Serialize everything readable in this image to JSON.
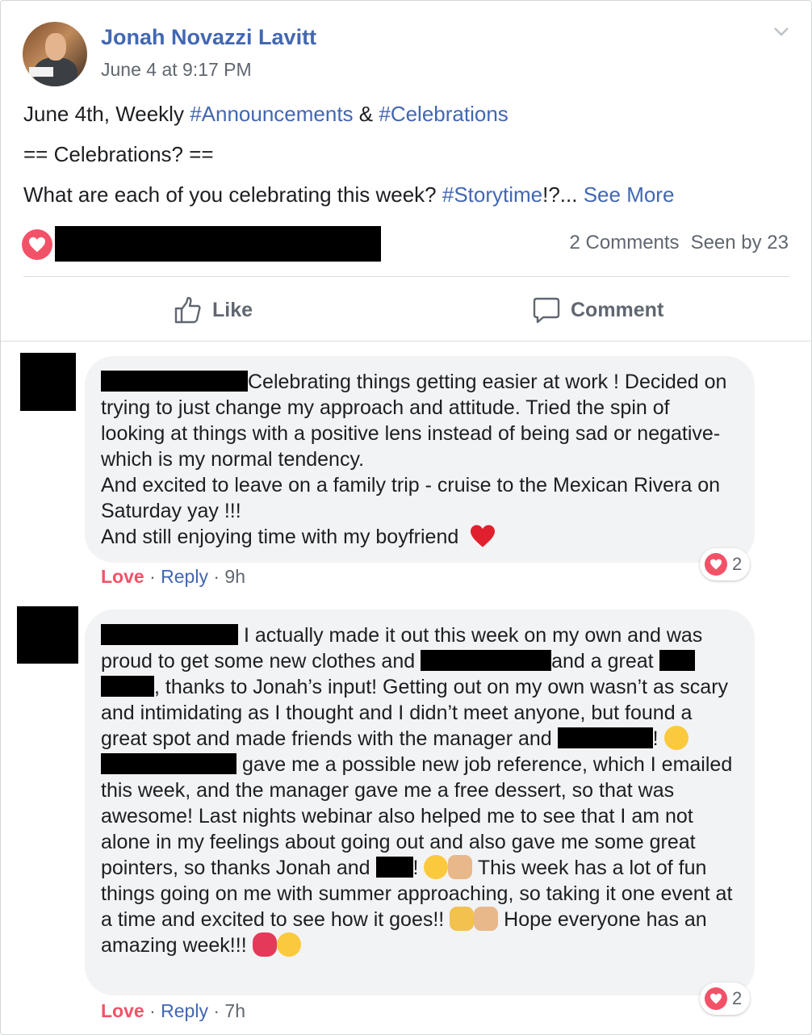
{
  "post": {
    "author": "Jonah Novazzi Lavitt",
    "timestamp": "June 4 at 9:17 PM",
    "line1": {
      "prefix": "June 4th, Weekly ",
      "tag1": "#Announcements",
      "amp": " & ",
      "tag2": "#Celebrations"
    },
    "line2": "== Celebrations? ==",
    "line3": {
      "text": "What are each of you celebrating this week? ",
      "tag": "#Storytime",
      "suffix": "!?... ",
      "see_more": "See More"
    },
    "comments_count": "2 Comments",
    "seen_by": "Seen by 23",
    "like_label": "Like",
    "comment_label": "Comment"
  },
  "comments": [
    {
      "text": "Celebrating things getting easier at work ! Decided on trying to just change my approach and attitude. Tried the spin of looking at things with a positive lens instead of being sad or negative- which is my normal tendency.",
      "l4": "And excited to leave on a family trip - cruise to the Mexican Rivera on Saturday yay !!!",
      "l6": "And still enjoying time with my boyfriend",
      "reaction_count": "2",
      "love": "Love",
      "reply": "Reply",
      "age": "9h"
    },
    {
      "s1": "I actually made it out this week on my own and was proud to get some new clothes and ",
      "s2": "and a great ",
      "s3": ", thanks to Jonah’s input! Getting out on my own wasn’t as scary and intimidating as I thought and I didn’t meet anyone, but found a great spot and made friends with the manager and ",
      "s4": "! ",
      "s5": " gave me a possible new job reference, which I emailed this week, and the manager gave me a free dessert, so that was awesome! Last nights webinar also helped me to see that I am not alone in my feelings about going out and also gave me some great pointers, so thanks Jonah and ",
      "s6": "! ",
      "s7": " This week has a lot of fun things going on me with summer approaching, so taking it one event at a time and excited to see how it goes!! ",
      "s8": " Hope everyone has an amazing week!!! ",
      "reaction_count": "2",
      "love": "Love",
      "reply": "Reply",
      "age": "7h"
    }
  ],
  "colors": {
    "link": "#4267b2",
    "love": "#f25268",
    "muted": "#606770",
    "bubble": "#f2f3f5"
  },
  "icons": [
    "chevron-down-icon",
    "love-reaction-icon",
    "like-thumb-icon",
    "comment-bubble-icon",
    "red-heart-emoji",
    "wink-emoji",
    "grin-emoji",
    "thumbs-up-emoji",
    "crossed-fingers-emoji",
    "flexed-arm-emoji",
    "two-hearts-emoji",
    "smile-emoji"
  ]
}
